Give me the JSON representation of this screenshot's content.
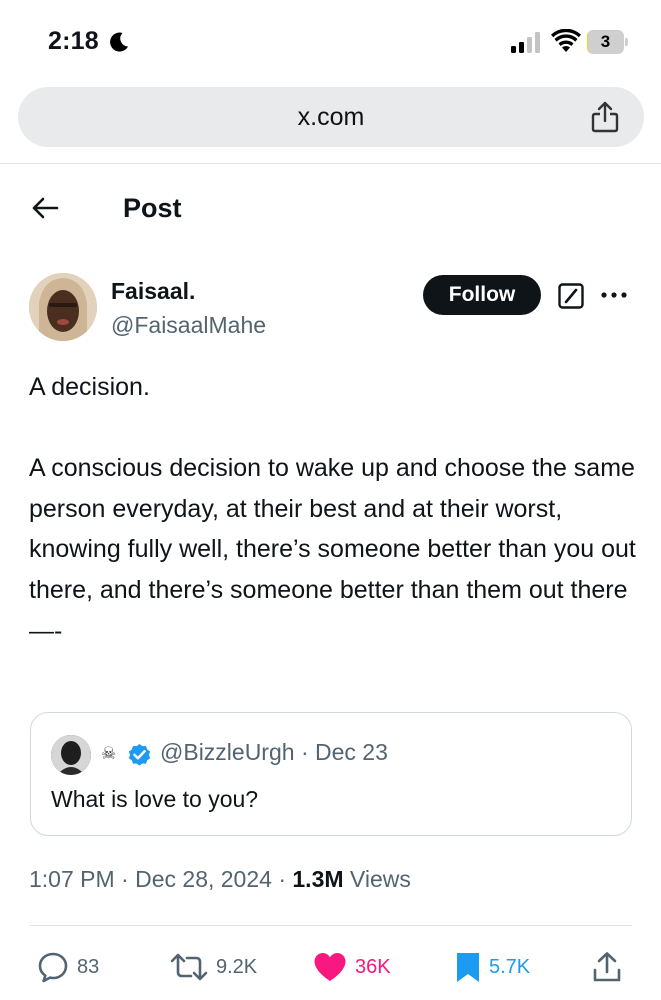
{
  "status_bar": {
    "time": "2:18",
    "battery_level": "3",
    "battery_fraction": 0.03,
    "icons": [
      "moon-icon",
      "signal-icon",
      "wifi-icon",
      "battery-icon"
    ]
  },
  "browser": {
    "url": "x.com",
    "share_icon": "share-icon"
  },
  "header": {
    "title": "Post",
    "back_icon": "arrow-left-icon"
  },
  "author": {
    "name": "Faisaal.",
    "handle": "@FaisaalMahe",
    "follow_label": "Follow",
    "icons": [
      "grok-icon",
      "more-icon"
    ]
  },
  "tweet": {
    "text": "A decision.\n\nA conscious decision to wake up and choose the same person everyday, at their best and at their worst, knowing fully well, there’s someone better than you out there, and there’s someone better than them out there\n—-"
  },
  "quote": {
    "emoji": "☠",
    "handle": "@BizzleUrgh",
    "separator": " · ",
    "date": "Dec 23",
    "text": "What is love to you?"
  },
  "meta": {
    "time": "1:07 PM",
    "date": "Dec 28, 2024",
    "views_count": "1.3M",
    "views_label": "Views",
    "separator": " · "
  },
  "actions": {
    "replies": "83",
    "reposts": "9.2K",
    "likes": "36K",
    "bookmarks": "5.7K"
  },
  "colors": {
    "text": "#0f1419",
    "secondary": "#536471",
    "like": "#f91880",
    "bookmark": "#1d9bf0",
    "verified": "#1d9bf0",
    "battery": "#ffd60a"
  }
}
